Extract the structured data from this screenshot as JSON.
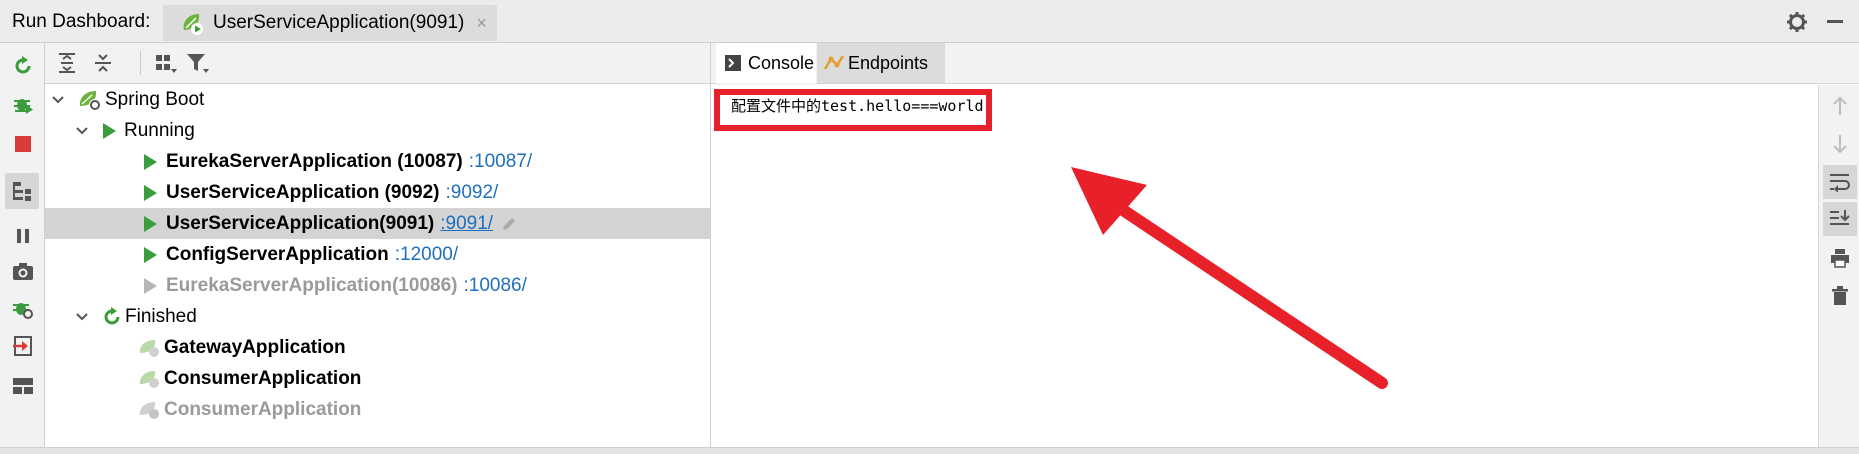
{
  "titlebar": {
    "label": "Run Dashboard:",
    "tab_label": "UserServiceApplication(9091)",
    "close_glyph": "×"
  },
  "left_toolbar": {
    "icons": [
      "rerun-icon",
      "debug-icon",
      "stop-icon",
      "group-by-type-icon",
      "pause-icon",
      "camera-icon",
      "debug-settings-icon",
      "exit-icon",
      "layout-icon"
    ]
  },
  "tree_toolbar": {
    "icons": [
      "expand-all-icon",
      "collapse-all-icon",
      "group-icon",
      "filter-icon"
    ]
  },
  "tree": {
    "spring_boot": "Spring Boot",
    "running": "Running",
    "finished": "Finished",
    "running_items": [
      {
        "name": "EurekaServerApplication (10087)",
        "port": ":10087/"
      },
      {
        "name": "UserServiceApplication (9092)",
        "port": ":9092/"
      },
      {
        "name": "UserServiceApplication(9091)",
        "port": ":9091/"
      },
      {
        "name": "ConfigServerApplication",
        "port": ":12000/"
      },
      {
        "name": "EurekaServerApplication(10086)",
        "port": ":10086/"
      }
    ],
    "finished_items": [
      {
        "name": "GatewayApplication"
      },
      {
        "name": "ConsumerApplication"
      },
      {
        "name": "ConsumerApplication"
      }
    ]
  },
  "console": {
    "tab_console": "Console",
    "tab_endpoints": "Endpoints",
    "output_line": "配置文件中的test.hello===world"
  },
  "colors": {
    "accent_green": "#3a9c3a",
    "link_blue": "#1f6fbf",
    "annotation_red": "#e8202a"
  }
}
